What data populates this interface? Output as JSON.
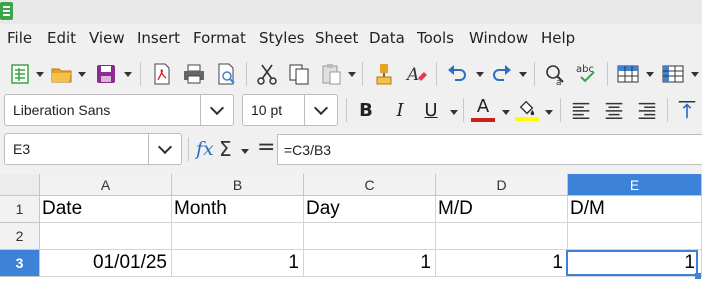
{
  "menubar": {
    "items": [
      "File",
      "Edit",
      "View",
      "Insert",
      "Format",
      "Styles",
      "Sheet",
      "Data",
      "Tools",
      "Window",
      "Help"
    ]
  },
  "toolbar": {
    "icons": [
      "new-icon",
      "open-icon",
      "save-icon",
      "export-pdf-icon",
      "print-icon",
      "print-preview-icon",
      "cut-icon",
      "copy-icon",
      "paste-icon",
      "clone-formatting-icon",
      "clear-formatting-icon",
      "undo-icon",
      "redo-icon",
      "find-replace-icon",
      "spelling-icon",
      "row-icon",
      "column-icon"
    ],
    "spelling_label": "abc"
  },
  "format": {
    "font_name": "Liberation Sans",
    "font_size": "10 pt",
    "bold": "B",
    "italic": "I",
    "underline": "U",
    "font_color": "A",
    "font_color_hex": "#c9211e",
    "highlight_hex": "#ffff00"
  },
  "formula": {
    "name_box": "E3",
    "fx": "fx",
    "sigma": "Σ",
    "equals": "=",
    "content": "=C3/B3"
  },
  "sheet": {
    "columns": [
      "A",
      "B",
      "C",
      "D",
      "E"
    ],
    "selected_column": "E",
    "rows": [
      "1",
      "2",
      "3"
    ],
    "selected_row": "3",
    "selected_cell": "E3",
    "cells": {
      "A1": "Date",
      "B1": "Month",
      "C1": "Day",
      "D1": "M/D",
      "E1": "D/M",
      "A3": "01/01/25",
      "B3": "1",
      "C3": "1",
      "D3": "1",
      "E3": "1"
    }
  },
  "colors": {
    "accent": "#3c82d8",
    "app_green": "#3aa54a"
  }
}
